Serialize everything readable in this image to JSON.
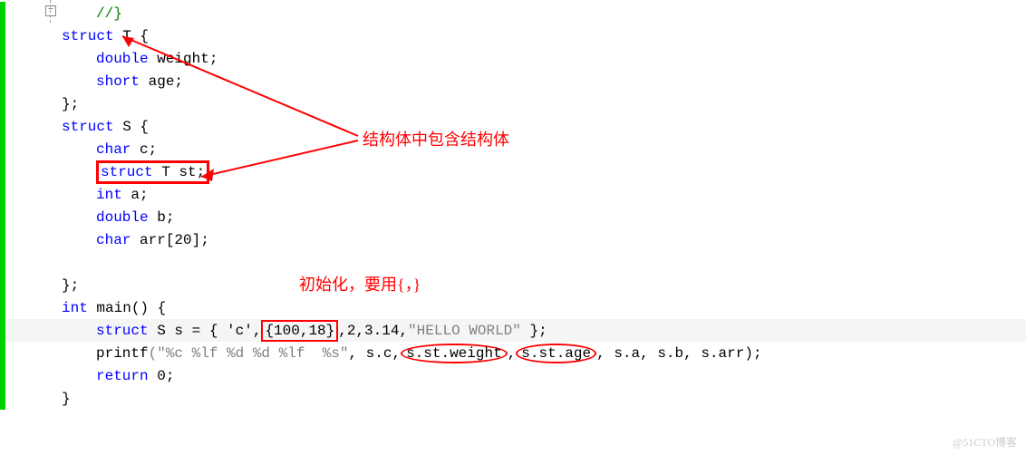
{
  "code": {
    "l1": "//}",
    "struct_kw": "struct",
    "T_name": "T {",
    "double_kw": "double",
    "weight": " weight;",
    "short_kw": "short",
    "age": " age;",
    "close1": "};",
    "S_name": "S {",
    "char_kw": "char",
    "c_decl": " c;",
    "st_decl_kw": "struct",
    "st_decl": " T st;",
    "int_kw": "int",
    "a_decl": " a;",
    "b_decl": " b;",
    "arr_decl": " arr[20];",
    "close2": "};",
    "main_kw": "int",
    "main_sig": " main() {",
    "s_decl_start": "struct",
    "s_decl_mid": " S s = { 'c',",
    "s_decl_init": "{100,18}",
    "s_decl_rest": ",2,3.14,",
    "s_decl_str": "\"HELLO WORLD\"",
    "s_decl_end": " };",
    "printf_name": "printf",
    "printf_fmt": "(\"%c %lf %d %d %lf  %s\"",
    "printf_args1": ", s.c,",
    "printf_st1": "s.st.weight",
    "printf_comma": ",",
    "printf_st2": "s.st.age",
    "printf_args2": ", s.a, s.b, s.arr);",
    "return_kw": "return",
    "return_val": " 0;",
    "close3": "}"
  },
  "annotations": {
    "a1": "结构体中包含结构体",
    "a2": "初始化，要用{，}"
  },
  "watermark": "@51CTO博客"
}
